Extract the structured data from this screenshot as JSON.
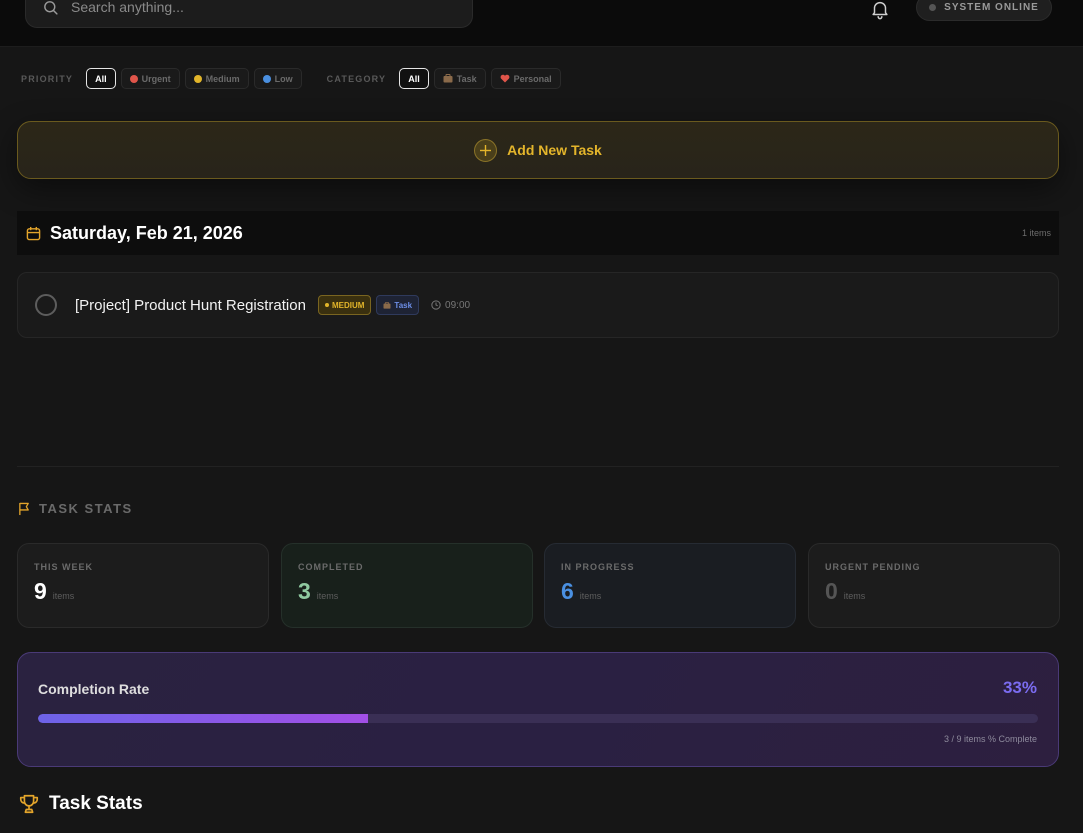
{
  "header": {
    "search_placeholder": "Search anything...",
    "system_status": "SYSTEM ONLINE"
  },
  "filters": {
    "priority_label": "PRIORITY",
    "priority_options": [
      {
        "label": "All",
        "active": true
      },
      {
        "label": "Urgent",
        "color": "#e0554a"
      },
      {
        "label": "Medium",
        "color": "#e2b52a"
      },
      {
        "label": "Low",
        "color": "#4a8fe0"
      }
    ],
    "category_label": "CATEGORY",
    "category_options": [
      {
        "label": "All",
        "active": true
      },
      {
        "label": "Task"
      },
      {
        "label": "Personal"
      }
    ]
  },
  "add_task_label": "Add New Task",
  "date_group": {
    "date": "Saturday, Feb 21, 2026",
    "count": "1 items"
  },
  "tasks": [
    {
      "title": "[Project] Product Hunt Registration",
      "priority": "MEDIUM",
      "category": "Task",
      "time": "09:00"
    }
  ],
  "stats_heading": "TASK STATS",
  "stats": [
    {
      "label": "THIS WEEK",
      "value": "9",
      "unit": "items",
      "color": "#ffffff"
    },
    {
      "label": "COMPLETED",
      "value": "3",
      "unit": "items",
      "color": "#8fc9a0"
    },
    {
      "label": "IN PROGRESS",
      "value": "6",
      "unit": "items",
      "color": "#4a90e2"
    },
    {
      "label": "URGENT PENDING",
      "value": "0",
      "unit": "items",
      "color": "#555555"
    }
  ],
  "completion": {
    "title": "Completion Rate",
    "percent_label": "33%",
    "fraction": 0.33,
    "subtitle": "3 / 9 items % Complete"
  },
  "bottom_heading": "Task Stats",
  "colors": {
    "accent_gold": "#e4b52b",
    "accent_purple": "#7b6cf0"
  }
}
